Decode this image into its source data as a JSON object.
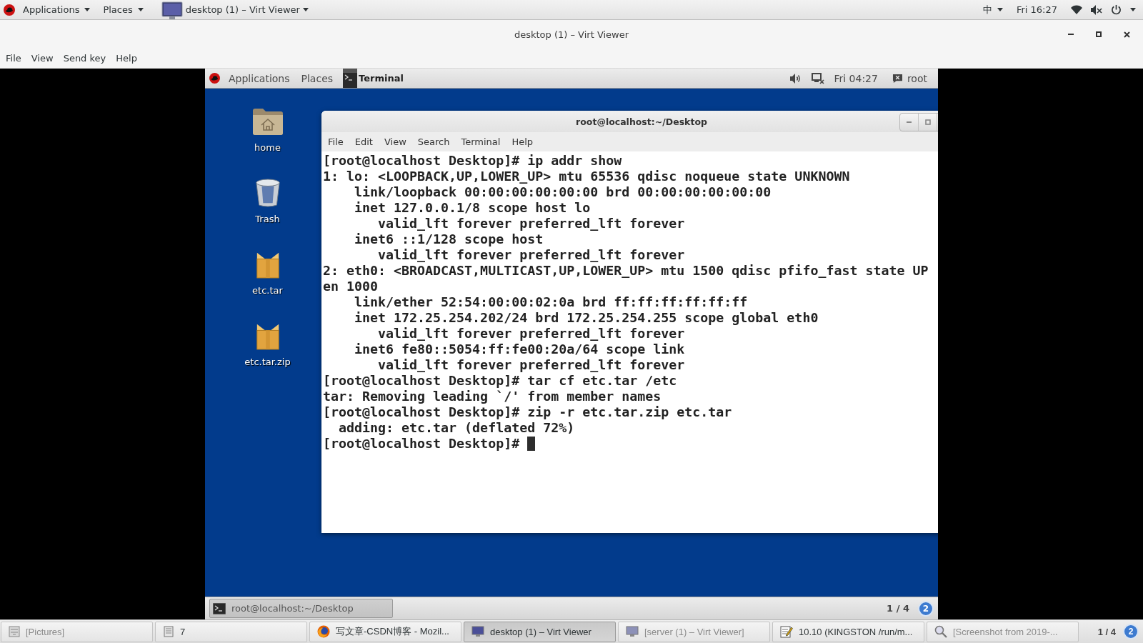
{
  "host_top_bar": {
    "menus": [
      "Applications",
      "Places"
    ],
    "active_window": "desktop (1) – Virt Viewer",
    "input_method": "中",
    "clock": "Fri 16:27"
  },
  "window": {
    "title": "desktop (1) – Virt Viewer",
    "menu": [
      "File",
      "View",
      "Send key",
      "Help"
    ]
  },
  "guest": {
    "top_bar": {
      "menus": [
        "Applications",
        "Places"
      ],
      "active_app": "Terminal",
      "clock": "Fri 04:27",
      "user": "root"
    },
    "desktop_icons": [
      {
        "label": "home",
        "kind": "home"
      },
      {
        "label": "Trash",
        "kind": "trash"
      },
      {
        "label": "etc.tar",
        "kind": "archive"
      },
      {
        "label": "etc.tar.zip",
        "kind": "archive"
      }
    ],
    "terminal": {
      "title": "root@localhost:~/Desktop",
      "menu": [
        "File",
        "Edit",
        "View",
        "Search",
        "Terminal",
        "Help"
      ],
      "lines": [
        "[root@localhost Desktop]# ip addr show",
        "1: lo: <LOOPBACK,UP,LOWER_UP> mtu 65536 qdisc noqueue state UNKNOWN",
        "    link/loopback 00:00:00:00:00:00 brd 00:00:00:00:00:00",
        "    inet 127.0.0.1/8 scope host lo",
        "       valid_lft forever preferred_lft forever",
        "    inet6 ::1/128 scope host",
        "       valid_lft forever preferred_lft forever",
        "2: eth0: <BROADCAST,MULTICAST,UP,LOWER_UP> mtu 1500 qdisc pfifo_fast state UP",
        "en 1000",
        "    link/ether 52:54:00:00:02:0a brd ff:ff:ff:ff:ff:ff",
        "    inet 172.25.254.202/24 brd 172.25.254.255 scope global eth0",
        "       valid_lft forever preferred_lft forever",
        "    inet6 fe80::5054:ff:fe00:20a/64 scope link",
        "       valid_lft forever preferred_lft forever",
        "[root@localhost Desktop]# tar cf etc.tar /etc",
        "tar: Removing leading `/' from member names",
        "[root@localhost Desktop]# zip -r etc.tar.zip etc.tar",
        "  adding: etc.tar (deflated 72%)",
        "[root@localhost Desktop]#"
      ],
      "cursor": true
    },
    "bottom_bar": {
      "windows": [
        {
          "label": "root@localhost:~/Desktop",
          "selected": true
        }
      ],
      "workspace": "1 / 4",
      "notifications": "2"
    }
  },
  "taskbar": {
    "items": [
      {
        "label": "[Pictures]",
        "kind": "files",
        "minimized": true,
        "selected": false
      },
      {
        "label": "7",
        "kind": "document",
        "minimized": false,
        "selected": false
      },
      {
        "label": "写文章-CSDN博客 - Mozil...",
        "kind": "browser",
        "minimized": false,
        "selected": false
      },
      {
        "label": "desktop (1) – Virt Viewer",
        "kind": "viewer",
        "minimized": false,
        "selected": true
      },
      {
        "label": "[server (1) – Virt Viewer]",
        "kind": "viewer",
        "minimized": true,
        "selected": false
      },
      {
        "label": "10.10 (KINGSTON /run/m...",
        "kind": "editor",
        "minimized": false,
        "selected": false
      },
      {
        "label": "[Screenshot from 2019-...",
        "kind": "screenshot",
        "minimized": true,
        "selected": false
      }
    ],
    "workspace": "1 / 4",
    "notifications": "2"
  }
}
